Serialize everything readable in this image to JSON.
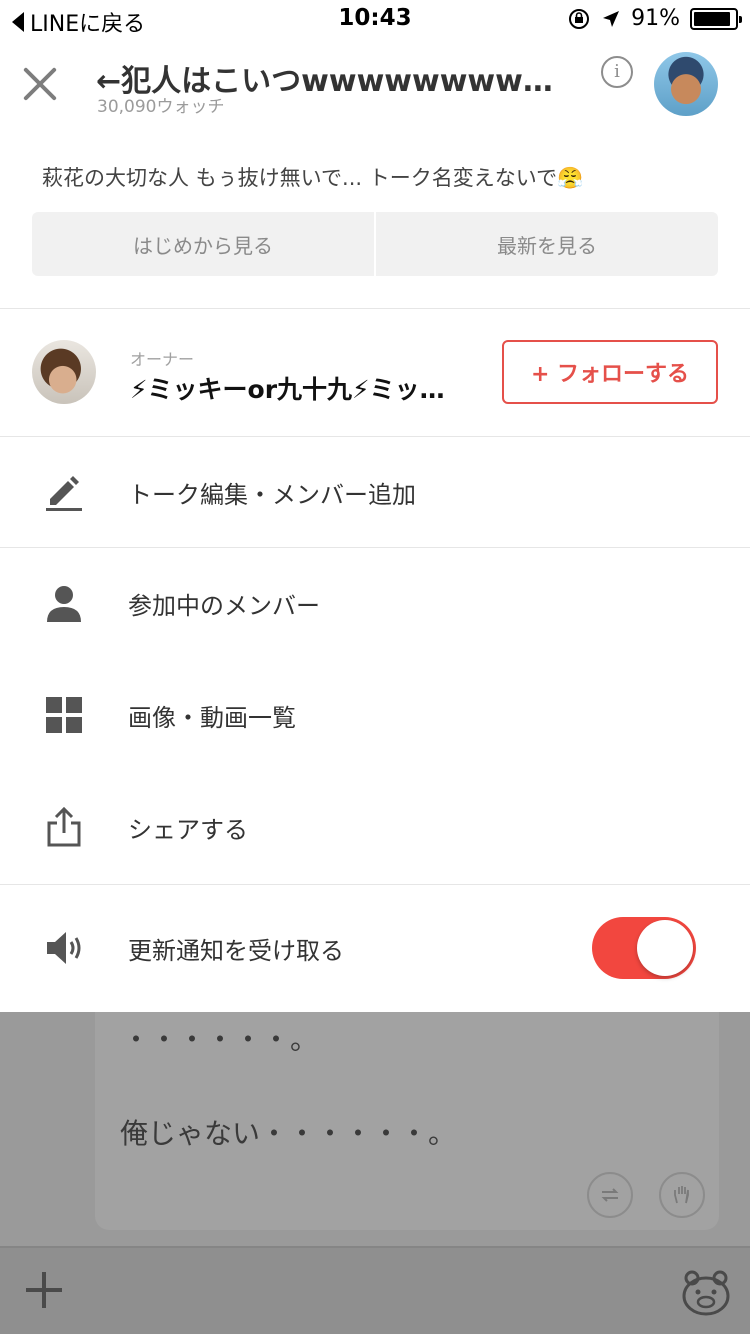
{
  "status_bar": {
    "back_app": "LINEに戻る",
    "time": "10:43",
    "battery": "91%",
    "battery_level": 0.91
  },
  "header": {
    "title": "←犯人はこいつwwwwwwwwwwwwwwww",
    "watch_count": "30,090ウォッチ"
  },
  "description": "萩花の大切な人 もぅ抜け無いで... トーク名変えないで😤",
  "view_buttons": {
    "from_start": "はじめから見る",
    "latest": "最新を見る"
  },
  "owner": {
    "label": "オーナー",
    "name": "⚡ミッキーor九十九⚡ミッキーor九十九",
    "follow_label": "+ フォローする"
  },
  "menu": {
    "edit": "トーク編集・メンバー追加",
    "members": "参加中のメンバー",
    "media": "画像・動画一覧",
    "share": "シェアする",
    "notify": "更新通知を受け取る",
    "notify_on": true
  },
  "background_post": {
    "line1": "・・・・・・。",
    "line2": "俺じゃない・・・・・・。"
  },
  "colors": {
    "accent": "#e5504a",
    "toggle_on": "#f2473f"
  },
  "icons": {
    "close": "close-icon",
    "info": "info-icon",
    "edit": "pencil-icon",
    "members": "person-icon",
    "media": "grid-icon",
    "share": "share-icon",
    "notify": "speaker-icon"
  }
}
